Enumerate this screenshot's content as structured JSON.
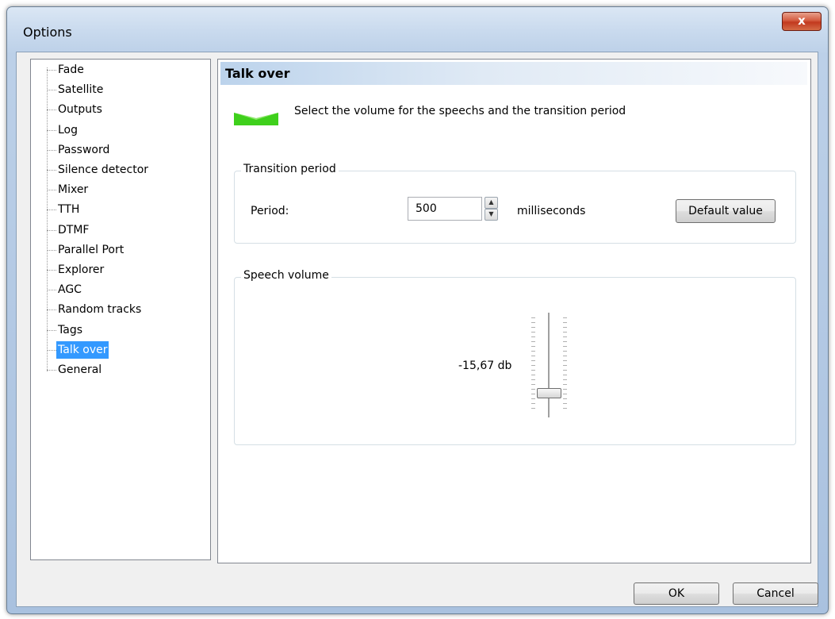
{
  "window": {
    "title": "Options",
    "close_label": "x"
  },
  "tree": {
    "items": [
      {
        "label": "Fade"
      },
      {
        "label": "Satellite"
      },
      {
        "label": "Outputs"
      },
      {
        "label": "Log"
      },
      {
        "label": "Password"
      },
      {
        "label": "Silence detector"
      },
      {
        "label": "Mixer"
      },
      {
        "label": "TTH"
      },
      {
        "label": "DTMF"
      },
      {
        "label": "Parallel Port"
      },
      {
        "label": "Explorer"
      },
      {
        "label": "AGC"
      },
      {
        "label": "Random tracks"
      },
      {
        "label": "Tags"
      },
      {
        "label": "Talk over",
        "selected": true
      },
      {
        "label": "General"
      }
    ]
  },
  "panel": {
    "title": "Talk over",
    "intro_text": "Select the volume for the speechs and the transition period"
  },
  "transition": {
    "group_title": "Transition period",
    "period_label": "Period:",
    "period_value": "500",
    "unit_label": "milliseconds",
    "default_button": "Default value"
  },
  "speech": {
    "group_title": "Speech volume",
    "volume_label": "-15,67 db",
    "slider_position": 0.8
  },
  "footer": {
    "ok": "OK",
    "cancel": "Cancel"
  },
  "colors": {
    "selection": "#3399ff",
    "icon_green": "#3fd01c"
  }
}
